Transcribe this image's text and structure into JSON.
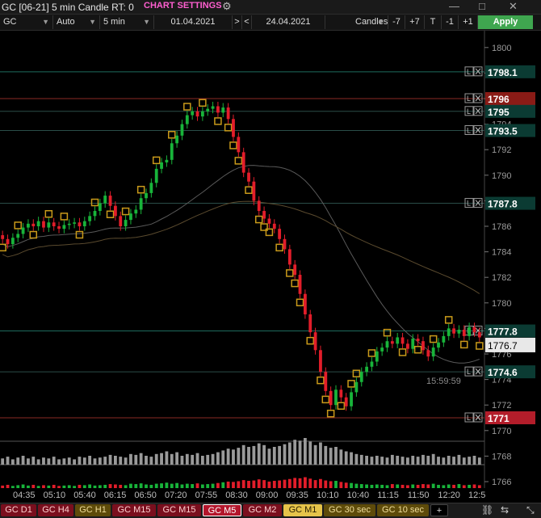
{
  "window": {
    "title": "GC [06-21] 5 min Candle RT: 0",
    "settings_label": "CHART SETTINGS",
    "gear_icon": "gear-icon",
    "minimize": "—",
    "maximize": "□",
    "close": "✕"
  },
  "toolbar": {
    "symbol": "GC",
    "scale": "Auto",
    "interval": "5 min",
    "start_date": "01.04.2021",
    "nav_forward": ">",
    "nav_back": "<",
    "end_date": "24.04.2021",
    "chart_type": "Candles",
    "minus7": "-7",
    "plus7": "+7",
    "t_button": "T",
    "minus1": "-1",
    "plus1": "+1",
    "apply": "Apply"
  },
  "price_axis": {
    "ticks": [
      "1800",
      "1798",
      "1796",
      "1794",
      "1792",
      "1790",
      "1788",
      "1786",
      "1784",
      "1782",
      "1780",
      "1778",
      "1776",
      "1774",
      "1772",
      "1770",
      "1768",
      "1766"
    ],
    "levels": [
      {
        "price": 1798.1,
        "label": "1798.1",
        "color": "#0b3b33",
        "line": "#1e6b5e"
      },
      {
        "price": 1796,
        "label": "1796",
        "color": "#8a1b16",
        "line": "#8a2a24"
      },
      {
        "price": 1795,
        "label": "1795",
        "color": "#0b3b33",
        "line": "#2a4d48"
      },
      {
        "price": 1793.5,
        "label": "1793.5",
        "color": "#0b3b33",
        "line": "#2a4d48"
      },
      {
        "price": 1787.8,
        "label": "1787.8",
        "color": "#0b3b33",
        "line": "#2a4d48"
      },
      {
        "price": 1777.8,
        "label": "1777.8",
        "color": "#0b3b33",
        "line": "#1e6b5e"
      },
      {
        "price": 1774.6,
        "label": "1774.6",
        "color": "#0b3b33",
        "line": "#2a4d48"
      },
      {
        "price": 1771,
        "label": "1771",
        "color": "#b31d2a",
        "line": "#8a2a24"
      }
    ],
    "current_price": "1776.7",
    "countdown": "15:59:59",
    "level_box_label": "L"
  },
  "time_axis": [
    "04:35",
    "05:10",
    "05:40",
    "06:15",
    "06:50",
    "07:20",
    "07:55",
    "08:30",
    "09:00",
    "09:35",
    "10:10",
    "10:40",
    "11:15",
    "11:50",
    "12:20",
    "12:5"
  ],
  "chart_data": {
    "type": "candlestick",
    "symbol": "GC",
    "interval": "5 min",
    "y_range": [
      1766,
      1801
    ],
    "closes": [
      1785.0,
      1784.6,
      1785.1,
      1785.4,
      1785.9,
      1786.2,
      1786.0,
      1786.4,
      1785.9,
      1786.3,
      1786.0,
      1785.8,
      1786.1,
      1786.2,
      1786.3,
      1786.0,
      1786.4,
      1786.8,
      1787.2,
      1787.8,
      1788.4,
      1787.6,
      1786.8,
      1786.0,
      1786.5,
      1787.0,
      1787.3,
      1788.2,
      1788.6,
      1789.4,
      1790.5,
      1791.0,
      1791.2,
      1792.5,
      1793.1,
      1794.0,
      1794.7,
      1795.0,
      1794.6,
      1795.0,
      1795.2,
      1795.4,
      1794.9,
      1795.3,
      1794.4,
      1793.0,
      1791.8,
      1790.2,
      1789.5,
      1788.0,
      1787.2,
      1786.6,
      1786.2,
      1785.8,
      1785.0,
      1784.2,
      1783.0,
      1782.2,
      1780.7,
      1779.1,
      1777.7,
      1776.3,
      1774.6,
      1773.1,
      1772.0,
      1773.2,
      1772.6,
      1771.9,
      1773.0,
      1773.8,
      1774.6,
      1775.0,
      1775.4,
      1776.2,
      1776.5,
      1777.0,
      1776.8,
      1777.3,
      1776.8,
      1776.4,
      1777.2,
      1777.0,
      1776.3,
      1775.8,
      1776.5,
      1776.9,
      1777.4,
      1778.0,
      1777.6,
      1777.9,
      1777.4,
      1778.1,
      1777.7,
      1777.3
    ],
    "volumes": [
      7,
      9,
      6,
      8,
      10,
      7,
      9,
      6,
      8,
      7,
      9,
      6,
      7,
      8,
      6,
      9,
      8,
      10,
      7,
      8,
      9,
      11,
      10,
      9,
      8,
      12,
      11,
      13,
      10,
      9,
      12,
      13,
      15,
      12,
      14,
      10,
      12,
      11,
      13,
      10,
      11,
      12,
      14,
      16,
      18,
      17,
      19,
      22,
      20,
      21,
      24,
      22,
      18,
      20,
      21,
      23,
      25,
      28,
      27,
      30,
      26,
      22,
      25,
      21,
      19,
      20,
      17,
      15,
      14,
      12,
      11,
      10,
      9,
      10,
      9,
      8,
      11,
      10,
      9,
      8,
      10,
      9,
      11,
      10,
      12,
      9,
      8,
      10,
      9,
      11,
      8,
      9,
      10,
      8
    ]
  },
  "tabs": [
    {
      "label": "GC D1",
      "style": "red"
    },
    {
      "label": "GC H4",
      "style": "red"
    },
    {
      "label": "GC H1",
      "style": "gold"
    },
    {
      "label": "GC M15",
      "style": "red"
    },
    {
      "label": "GC M15",
      "style": "red"
    },
    {
      "label": "GC M5",
      "style": "active-red"
    },
    {
      "label": "GC M2",
      "style": "red"
    },
    {
      "label": "GC M1",
      "style": "active-gold"
    },
    {
      "label": "GC 30 sec",
      "style": "gold"
    },
    {
      "label": "GC 10 sec",
      "style": "gold"
    },
    {
      "label": "+",
      "style": "plus"
    }
  ],
  "bottom_icons": [
    "link-icon",
    "left-right-arrows-icon",
    "resize-icon"
  ],
  "colors": {
    "up": "#18b43a",
    "down": "#e21d2a",
    "ma1": "#5a5a5a",
    "ma2": "#5a4a2e",
    "level_box": "#c99a1a"
  }
}
